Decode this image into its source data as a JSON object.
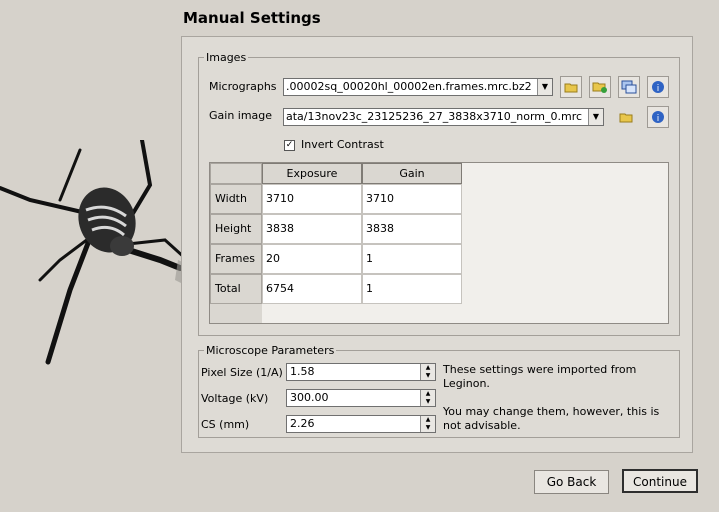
{
  "header": {
    "title": "Manual Settings"
  },
  "images": {
    "legend": "Images",
    "micrographs_label": "Micrographs",
    "micrographs_value": ".00002sq_00020hl_00002en.frames.mrc.bz2",
    "gain_label": "Gain image",
    "gain_value": "ata/13nov23c_23125236_27_3838x3710_norm_0.mrc",
    "invert_label": "Invert Contrast",
    "invert_checked": true,
    "table": {
      "columns": [
        "Exposure",
        "Gain"
      ],
      "rows": [
        {
          "label": "Width",
          "exposure": "3710",
          "gain": "3710"
        },
        {
          "label": "Height",
          "exposure": "3838",
          "gain": "3838"
        },
        {
          "label": "Frames",
          "exposure": "20",
          "gain": "1"
        },
        {
          "label": "Total",
          "exposure": "6754",
          "gain": "1"
        }
      ]
    }
  },
  "microscope": {
    "legend": "Microscope Parameters",
    "pixel_label": "Pixel Size (1/A)",
    "pixel_value": "1.58",
    "voltage_label": "Voltage (kV)",
    "voltage_value": "300.00",
    "cs_label": "CS (mm)",
    "cs_value": "2.26",
    "note1": "These settings were imported from Leginon.",
    "note2": "You may change them, however, this is not advisable."
  },
  "buttons": {
    "back": "Go Back",
    "continue": "Continue"
  },
  "icons": [
    "folder-icon",
    "folder-add-icon",
    "windows-icon",
    "info-icon",
    "folder-icon",
    "info-icon"
  ],
  "colors": {
    "background": "#d6d2cb",
    "info_blue": "#2f63c4",
    "folder_yellow": "#e8c64b"
  }
}
